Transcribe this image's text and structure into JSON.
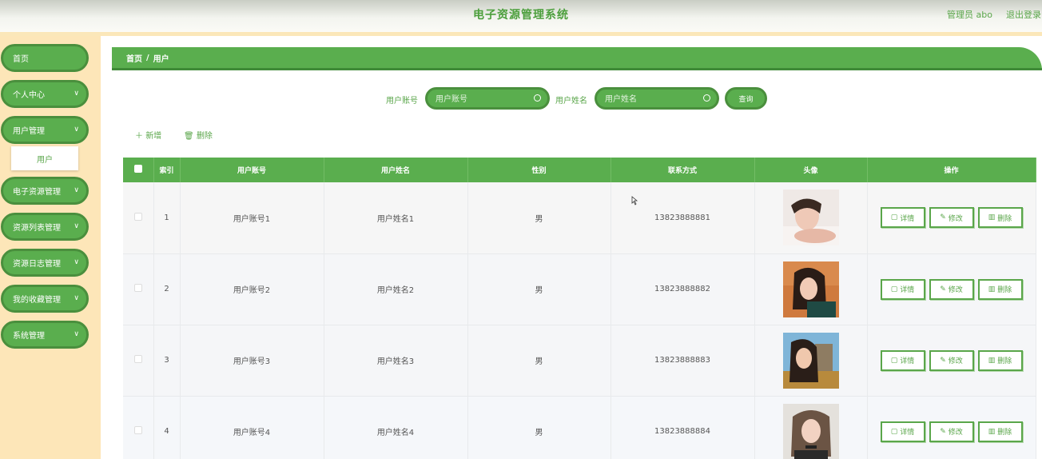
{
  "header": {
    "title": "电子资源管理系统",
    "admin": "管理员 abo",
    "logout": "退出登录"
  },
  "sidebar": {
    "items": [
      {
        "label": "首页",
        "has_arrow": false
      },
      {
        "label": "个人中心",
        "has_arrow": true
      },
      {
        "label": "用户管理",
        "has_arrow": true
      },
      {
        "label": "电子资源管理",
        "has_arrow": true
      },
      {
        "label": "资源列表管理",
        "has_arrow": true
      },
      {
        "label": "资源日志管理",
        "has_arrow": true
      },
      {
        "label": "我的收藏管理",
        "has_arrow": true
      },
      {
        "label": "系统管理",
        "has_arrow": true
      }
    ],
    "submenu_label": "用户"
  },
  "breadcrumb": {
    "home": "首页",
    "separator": "/",
    "current": "用户"
  },
  "search": {
    "account_label": "用户账号",
    "account_placeholder": "用户账号",
    "name_label": "用户姓名",
    "name_placeholder": "用户姓名",
    "query_button": "查询"
  },
  "actions": {
    "add": "新增",
    "delete": "删除"
  },
  "table": {
    "columns": [
      "索引",
      "用户账号",
      "用户姓名",
      "性别",
      "联系方式",
      "头像",
      "操作"
    ],
    "rows": [
      {
        "index": "1",
        "account": "用户账号1",
        "name": "用户姓名1",
        "gender": "男",
        "phone": "13823888881"
      },
      {
        "index": "2",
        "account": "用户账号2",
        "name": "用户姓名2",
        "gender": "男",
        "phone": "13823888882"
      },
      {
        "index": "3",
        "account": "用户账号3",
        "name": "用户姓名3",
        "gender": "男",
        "phone": "13823888883"
      },
      {
        "index": "4",
        "account": "用户账号4",
        "name": "用户姓名4",
        "gender": "男",
        "phone": "13823888884"
      }
    ],
    "row_buttons": {
      "detail": "详情",
      "edit": "修改",
      "delete": "删除"
    }
  },
  "colors": {
    "accent": "#5aae4e",
    "accent_dark": "#4a8f3d",
    "sidebar_bg": "#fde6b8"
  }
}
